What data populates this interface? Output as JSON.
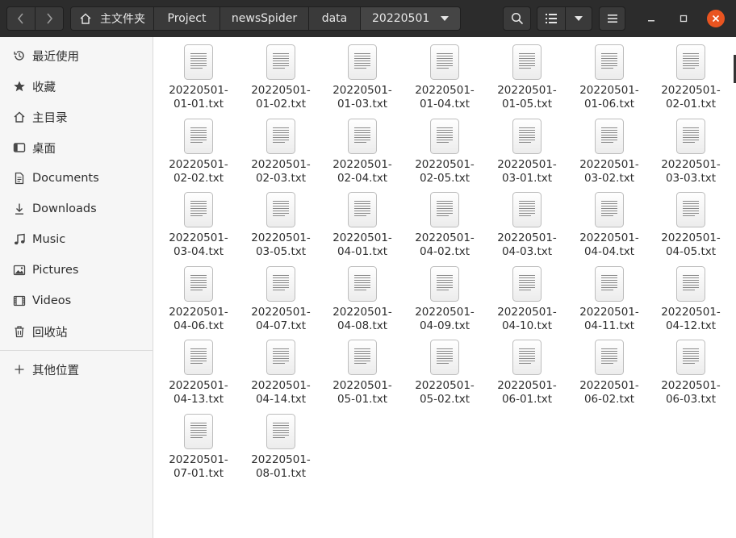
{
  "nav": {
    "back_icon": "chevron-left-icon",
    "forward_icon": "chevron-right-icon"
  },
  "path": {
    "home_label": "主文件夹",
    "crumbs": [
      "Project",
      "newsSpider",
      "data",
      "20220501"
    ]
  },
  "sidebar": {
    "items": [
      {
        "label": "最近使用",
        "icon": "clock-icon"
      },
      {
        "label": "收藏",
        "icon": "star-icon"
      },
      {
        "label": "主目录",
        "icon": "home-icon"
      },
      {
        "label": "桌面",
        "icon": "desktop-icon"
      },
      {
        "label": "Documents",
        "icon": "document-icon"
      },
      {
        "label": "Downloads",
        "icon": "download-icon"
      },
      {
        "label": "Music",
        "icon": "music-icon"
      },
      {
        "label": "Pictures",
        "icon": "picture-icon"
      },
      {
        "label": "Videos",
        "icon": "video-icon"
      },
      {
        "label": "回收站",
        "icon": "trash-icon"
      }
    ],
    "other_locations": "其他位置"
  },
  "files": [
    {
      "l1": "20220501-",
      "l2": "01-01.txt"
    },
    {
      "l1": "20220501-",
      "l2": "01-02.txt"
    },
    {
      "l1": "20220501-",
      "l2": "01-03.txt"
    },
    {
      "l1": "20220501-",
      "l2": "01-04.txt"
    },
    {
      "l1": "20220501-",
      "l2": "01-05.txt"
    },
    {
      "l1": "20220501-",
      "l2": "01-06.txt"
    },
    {
      "l1": "20220501-",
      "l2": "02-01.txt"
    },
    {
      "l1": "20220501-",
      "l2": "02-02.txt"
    },
    {
      "l1": "20220501-",
      "l2": "02-03.txt"
    },
    {
      "l1": "20220501-",
      "l2": "02-04.txt"
    },
    {
      "l1": "20220501-",
      "l2": "02-05.txt"
    },
    {
      "l1": "20220501-",
      "l2": "03-01.txt"
    },
    {
      "l1": "20220501-",
      "l2": "03-02.txt"
    },
    {
      "l1": "20220501-",
      "l2": "03-03.txt"
    },
    {
      "l1": "20220501-",
      "l2": "03-04.txt"
    },
    {
      "l1": "20220501-",
      "l2": "03-05.txt"
    },
    {
      "l1": "20220501-",
      "l2": "04-01.txt"
    },
    {
      "l1": "20220501-",
      "l2": "04-02.txt"
    },
    {
      "l1": "20220501-",
      "l2": "04-03.txt"
    },
    {
      "l1": "20220501-",
      "l2": "04-04.txt"
    },
    {
      "l1": "20220501-",
      "l2": "04-05.txt"
    },
    {
      "l1": "20220501-",
      "l2": "04-06.txt"
    },
    {
      "l1": "20220501-",
      "l2": "04-07.txt"
    },
    {
      "l1": "20220501-",
      "l2": "04-08.txt"
    },
    {
      "l1": "20220501-",
      "l2": "04-09.txt"
    },
    {
      "l1": "20220501-",
      "l2": "04-10.txt"
    },
    {
      "l1": "20220501-",
      "l2": "04-11.txt"
    },
    {
      "l1": "20220501-",
      "l2": "04-12.txt"
    },
    {
      "l1": "20220501-",
      "l2": "04-13.txt"
    },
    {
      "l1": "20220501-",
      "l2": "04-14.txt"
    },
    {
      "l1": "20220501-",
      "l2": "05-01.txt"
    },
    {
      "l1": "20220501-",
      "l2": "05-02.txt"
    },
    {
      "l1": "20220501-",
      "l2": "06-01.txt"
    },
    {
      "l1": "20220501-",
      "l2": "06-02.txt"
    },
    {
      "l1": "20220501-",
      "l2": "06-03.txt"
    },
    {
      "l1": "20220501-",
      "l2": "07-01.txt"
    },
    {
      "l1": "20220501-",
      "l2": "08-01.txt"
    }
  ],
  "colors": {
    "headerbar": "#2c2c2c",
    "close": "#e95420",
    "sidebar": "#f6f6f6"
  }
}
